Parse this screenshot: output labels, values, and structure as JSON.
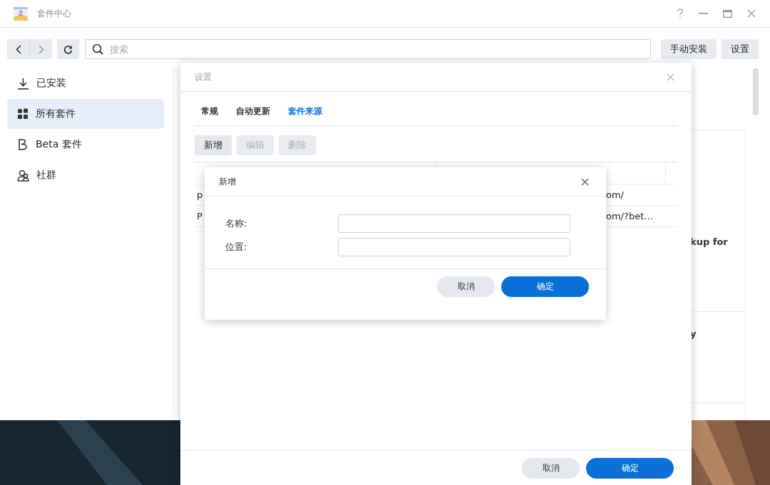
{
  "window": {
    "title": "套件中心"
  },
  "toolbar": {
    "search": {
      "placeholder": "搜索"
    },
    "buttons": [
      "手动安装",
      "设置"
    ]
  },
  "sidebar": {
    "items": [
      {
        "label": "已安装",
        "kind": "download",
        "selected": false
      },
      {
        "label": "所有套件",
        "kind": "grid",
        "selected": true
      },
      {
        "label": "Beta 套件",
        "kind": "beta",
        "selected": false
      },
      {
        "label": "社群",
        "kind": "people",
        "selected": false
      }
    ]
  },
  "cards": [
    {
      "title": "kup for"
    },
    {
      "title": "y"
    }
  ],
  "settings_dialog": {
    "title": "设置",
    "tabs": [
      {
        "label": "常规",
        "selected": false
      },
      {
        "label": "自动更新",
        "selected": false
      },
      {
        "label": "套件来源",
        "selected": true
      }
    ],
    "actions": [
      {
        "label": "新增",
        "disabled": false
      },
      {
        "label": "编辑",
        "disabled": true
      },
      {
        "label": "删除",
        "disabled": true
      }
    ],
    "table": {
      "rows": [
        {
          "column_1": "p",
          "column_2": "om/"
        },
        {
          "column_1": "P",
          "column_2": "om/?bet…"
        }
      ]
    },
    "buttons": [
      {
        "label": "取消",
        "kind": "secondary"
      },
      {
        "label": "确定",
        "kind": "primary"
      }
    ]
  },
  "add_dialog": {
    "title": "新增",
    "fields": [
      {
        "label": "名称:"
      },
      {
        "label": "位置:"
      }
    ],
    "buttons": [
      {
        "label": "取消",
        "kind": "secondary"
      },
      {
        "label": "确定",
        "kind": "primary"
      }
    ]
  }
}
